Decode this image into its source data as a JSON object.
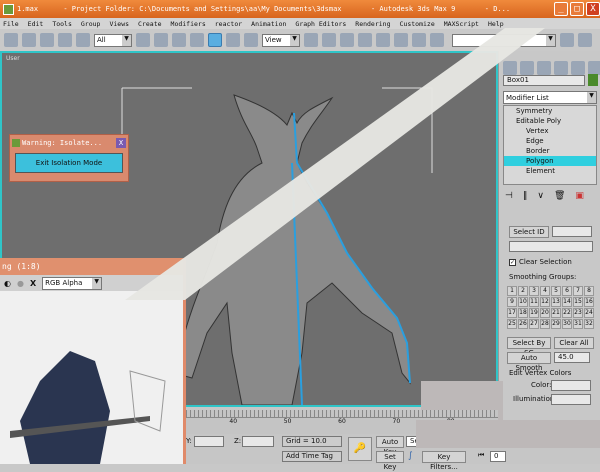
{
  "window": {
    "title": "1.max      - Project Folder: C:\\Documents and Settings\\aa\\My Documents\\3dsmax       - Autodesk 3ds Max 9       - D...",
    "minimize": "_",
    "maximize": "□",
    "close": "X"
  },
  "menu": [
    "File",
    "Edit",
    "Tools",
    "Group",
    "Views",
    "Create",
    "Modifiers",
    "reactor",
    "Animation",
    "Graph Editors",
    "Rendering",
    "Customize",
    "MAXScript",
    "Help"
  ],
  "toolbar": {
    "selection_filter": "All",
    "reference_coord": "View"
  },
  "viewport": {
    "label": "User"
  },
  "warning_dialog": {
    "title": "Warning: Isolate...",
    "close": "X",
    "button": "Exit Isolation Mode"
  },
  "render_window": {
    "title": "ng (1:8)",
    "channel": "RGB Alpha",
    "clear": "X"
  },
  "command_panel": {
    "object_name": "Box01",
    "object_color": "#4a8a2a",
    "modifier_list": "Modifier List",
    "stack": [
      {
        "label": "Symmetry"
      },
      {
        "label": "Editable Poly"
      },
      {
        "label": "Vertex"
      },
      {
        "label": "Edge"
      },
      {
        "label": "Border"
      },
      {
        "label": "Polygon",
        "selected": true
      },
      {
        "label": "Element"
      }
    ],
    "select_id": "Select ID",
    "clear_selection": "Clear Selection",
    "clear_selection_checked": true,
    "smoothing_groups_title": "Smoothing Groups:",
    "smoothing_groups": [
      "1",
      "2",
      "3",
      "4",
      "5",
      "6",
      "7",
      "8",
      "9",
      "10",
      "11",
      "12",
      "13",
      "14",
      "15",
      "16",
      "17",
      "18",
      "19",
      "20",
      "21",
      "22",
      "23",
      "24",
      "25",
      "26",
      "27",
      "28",
      "29",
      "30",
      "31",
      "32"
    ],
    "select_by_sg": "Select By SG",
    "clear_all": "Clear All",
    "auto_smooth": "Auto Smooth",
    "auto_smooth_value": "45.0",
    "vertex_colors_title": "Edit Vertex Colors",
    "color_label": "Color:",
    "illumination_label": "Illumination:"
  },
  "timeline": {
    "ticks": [
      "40",
      "50",
      "60",
      "70",
      "80"
    ]
  },
  "status": {
    "y_label": "Y:",
    "z_label": "Z:",
    "grid": "Grid = 10.0",
    "add_time_tag": "Add Time Tag",
    "auto_key": "Auto Key",
    "selected": "Selec",
    "set_key": "Set Key",
    "key_filters": "Key Filters...",
    "frame": "0"
  }
}
